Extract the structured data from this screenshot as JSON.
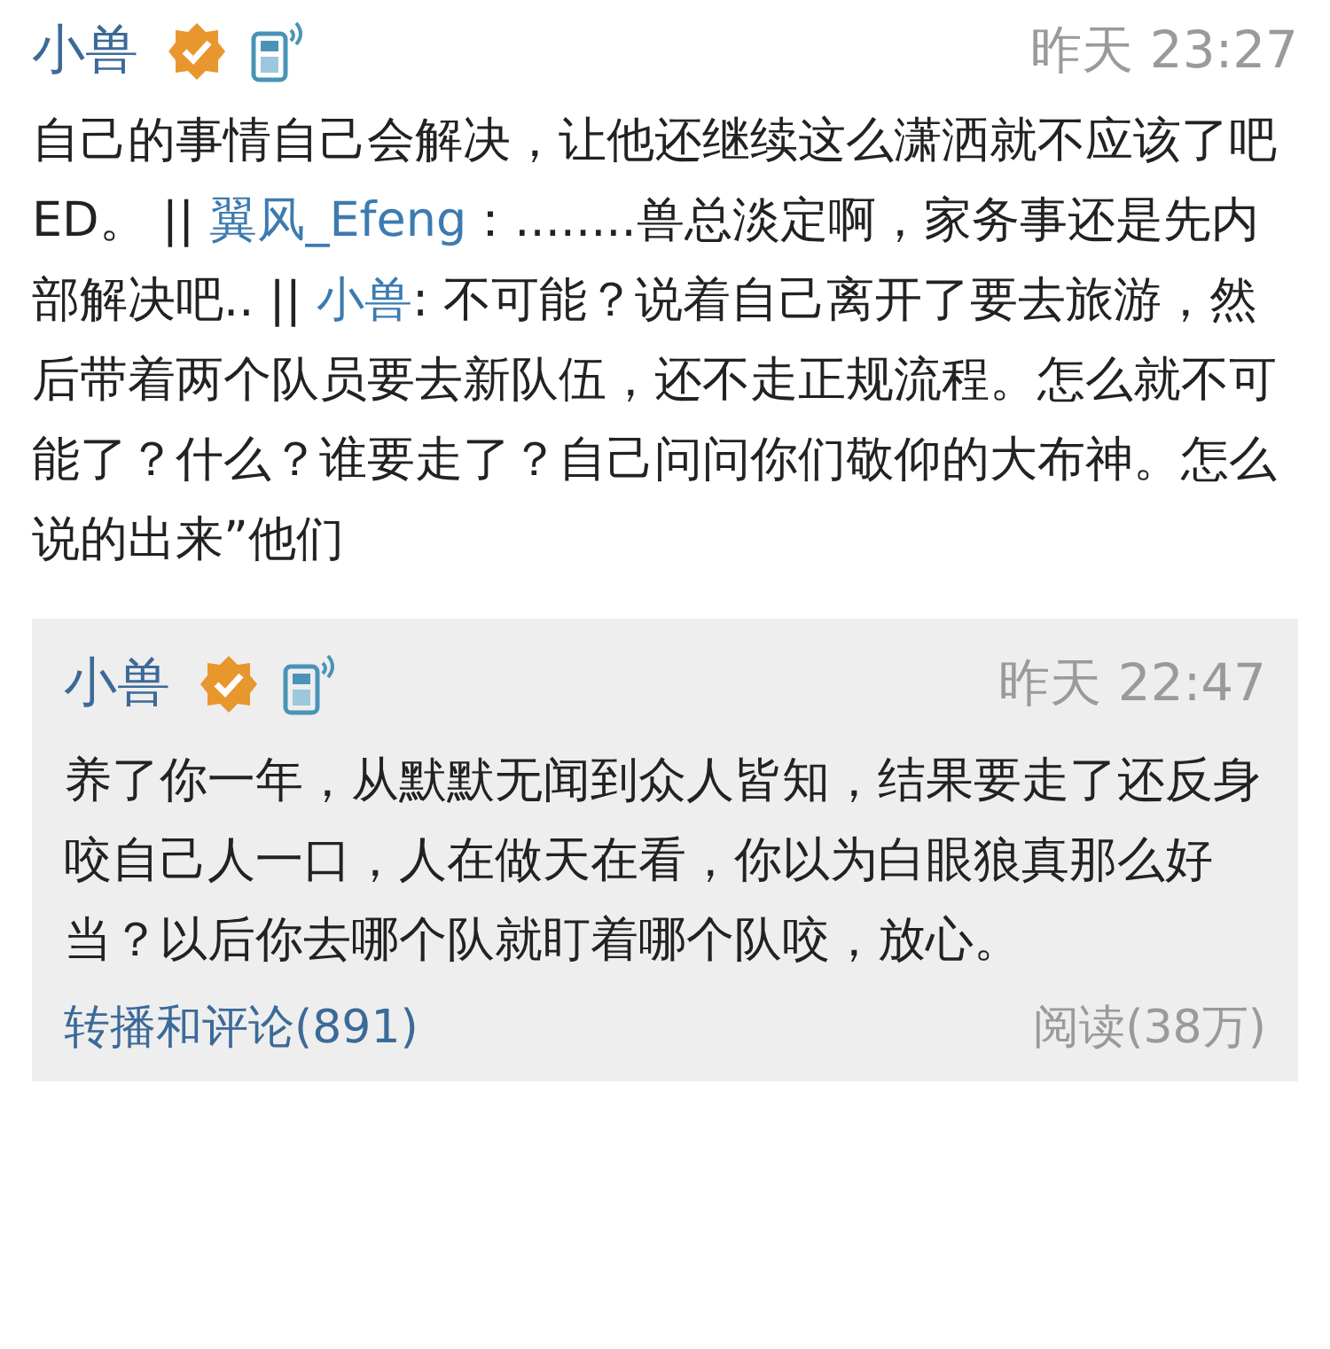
{
  "post": {
    "author": "小兽",
    "verified": true,
    "time": "昨天 23:27",
    "segments": [
      {
        "kind": "text",
        "text": "自己的事情自己会解决，让他还继续这么潇洒就不应该了吧ED。 || "
      },
      {
        "kind": "link",
        "text": "翼风_Efeng"
      },
      {
        "kind": "text",
        "text": "：........兽总淡定啊，家务事还是先内部解决吧.. || "
      },
      {
        "kind": "link",
        "text": "小兽"
      },
      {
        "kind": "text",
        "text": ": 不可能？说着自己离开了要去旅游，然后带着两个队员要去新队伍，还不走正规流程。怎么就不可能了？什么？谁要走了？自己问问你们敬仰的大布神。怎么说的出来”他们"
      }
    ]
  },
  "repost": {
    "author": "小兽",
    "verified": true,
    "time": "昨天 22:47",
    "text": "养了你一年，从默默无闻到众人皆知，结果要走了还反身咬自己人一口，人在做天在看，你以为白眼狼真那么好当？以后你去哪个队就盯着哪个队咬，放心。",
    "comments_link": "转播和评论(891)",
    "reads": "阅读(38万)"
  }
}
